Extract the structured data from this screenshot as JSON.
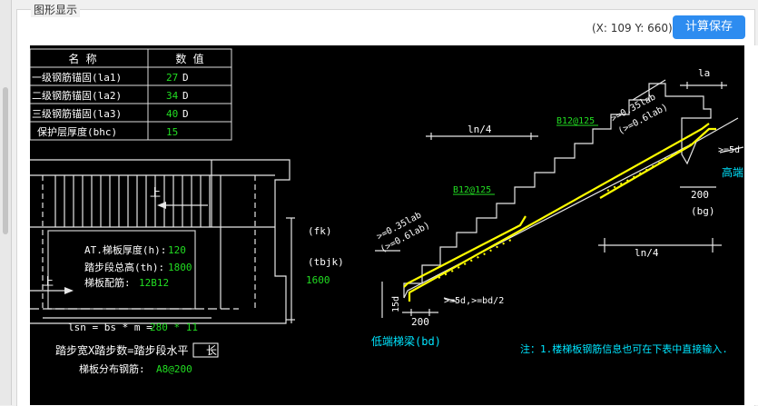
{
  "panel_title": "图形显示",
  "coords": "(X: 109 Y: 660)",
  "save_label": "计算保存",
  "colors": {
    "accent": "#2d8cf0",
    "canvas_bg": "#000000",
    "value_green": "#22dd22",
    "label_yellow": "#ffff00",
    "note_cyan": "#00e5ff"
  },
  "table": {
    "header": [
      "名 称",
      "数 值"
    ],
    "rows": [
      {
        "name": "一级钢筋锚固(la1)",
        "value": "27",
        "unit": "D"
      },
      {
        "name": "二级钢筋锚固(la2)",
        "value": "34",
        "unit": "D"
      },
      {
        "name": "三级钢筋锚固(la3)",
        "value": "40",
        "unit": "D"
      },
      {
        "name": "保护层厚度(bhc)",
        "value": "15",
        "unit": ""
      }
    ]
  },
  "plan": {
    "up_label": "上",
    "thickness_label": "AT.梯板厚度(h):",
    "thickness_value": "120",
    "height_label": "踏步段总高(th):",
    "height_value": "1800",
    "rebar_label": "梯板配筋:",
    "rebar_value": "12B12",
    "fk": "(fk)",
    "tbjk": "(tbjk)",
    "tbjk_value": "1600",
    "lsn_label": "lsn = bs * m =",
    "lsn_value": "280 * 11",
    "step_formula_a": "踏步宽X踏步数=踏步段水平",
    "step_formula_b": "长",
    "dist_label": "梯板分布钢筋:",
    "dist_value": "A8@200"
  },
  "section": {
    "la": "la",
    "ln4_top": "ln/4",
    "ln4_bottom": "ln/4",
    "b12_top": "B12@125",
    "b12_mid": "B12@125",
    "ge035_top": ">=0.35lab",
    "ge06_top": "(>=0.6lab)",
    "ge035_left": ">=0.35lab",
    "ge06_left": "(>=0.6lab)",
    "ge5d_right": ">=5d",
    "high_beam": "高端",
    "w200_right": "200",
    "bg": "(bg)",
    "d15": "15d",
    "ge5d_bottom": ">=5d,>=bd/2",
    "w200_left": "200",
    "low_beam": "低端梯梁(bd)",
    "note": "注：1.楼梯板钢筋信息也可在下表中直接输入."
  }
}
